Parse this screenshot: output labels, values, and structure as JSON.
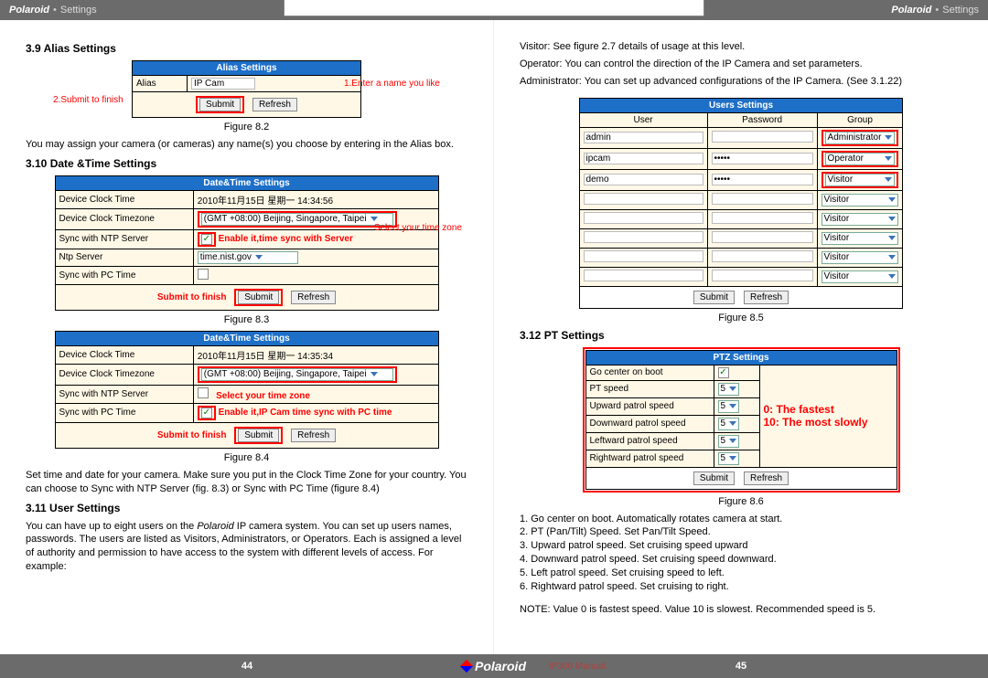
{
  "header": {
    "brand": "Polaroid",
    "sep": "•",
    "sub": "Settings"
  },
  "left": {
    "sec39_title": "3.9 Alias Settings",
    "fig82": {
      "title": "Alias Settings",
      "row_label": "Alias",
      "row_value": "IP Cam",
      "anno1": "1.Enter a name you like",
      "anno2": "2.Submit to finish",
      "submit": "Submit",
      "refresh": "Refresh",
      "caption": "Figure 8.2"
    },
    "p39": "You may assign your camera (or cameras) any name(s) you choose by entering in the Alias box.",
    "sec310_title": "3.10 Date &Time Settings",
    "fig83": {
      "title": "Date&Time Settings",
      "rows": {
        "dct_label": "Device Clock Time",
        "dct_value": "2010年11月15日 星期一 14:34:56",
        "dtz_label": "Device Clock Timezone",
        "dtz_value": "(GMT +08:00) Beijing, Singapore, Taipei",
        "ntp_label": "Sync with NTP Server",
        "ntp_anno": "Enable it,time sync with Server",
        "select_zone": "Select your time zone",
        "nsrv_label": "Ntp Server",
        "nsrv_value": "time.nist.gov",
        "pc_label": "Sync with PC Time"
      },
      "submit_to_finish": "Submit to finish",
      "submit": "Submit",
      "refresh": "Refresh",
      "caption": "Figure 8.3"
    },
    "fig84": {
      "title": "Date&Time Settings",
      "rows": {
        "dct_label": "Device Clock Time",
        "dct_value": "2010年11月15日 星期一 14:35:34",
        "dtz_label": "Device Clock Timezone",
        "dtz_value": "(GMT +08:00) Beijing, Singapore, Taipei",
        "ntp_label": "Sync with NTP Server",
        "select_zone": "Select your time zone",
        "pc_label": "Sync with PC Time",
        "pc_anno": "Enable it,IP Cam time sync with PC time"
      },
      "submit_to_finish": "Submit to finish",
      "submit": "Submit",
      "refresh": "Refresh",
      "caption": "Figure 8.4"
    },
    "p310": "Set time and date for your camera. Make sure you put in the Clock Time Zone for your country. You can choose to Sync with NTP Server (fig. 8.3) or Sync with PC Time (figure 8.4)",
    "sec311_title": "3.11 User Settings",
    "p311_1": "You can have up to eight users on the ",
    "p311_brand": "Polaroid",
    "p311_2": " IP camera system. You can set up users names, passwords. The users are listed as Visitors, Administrators, or Operators. Each is assigned a level of authority and permission to have access to the system with different levels of access. For example:"
  },
  "right": {
    "intro1": "Visitor: See figure 2.7 details of usage at this level.",
    "intro2": "Operator: You can control the direction of the IP Camera and set parameters.",
    "intro3": "Administrator: You can set up advanced configurations of the IP Camera. (See 3.1.22)",
    "fig85": {
      "title": "Users Settings",
      "headers": {
        "user": "User",
        "password": "Password",
        "group": "Group"
      },
      "rows": [
        {
          "user": "admin",
          "password": "",
          "group": "Administrator"
        },
        {
          "user": "ipcam",
          "password": "•••••",
          "group": "Operator"
        },
        {
          "user": "demo",
          "password": "•••••",
          "group": "Visitor"
        },
        {
          "user": "",
          "password": "",
          "group": "Visitor"
        },
        {
          "user": "",
          "password": "",
          "group": "Visitor"
        },
        {
          "user": "",
          "password": "",
          "group": "Visitor"
        },
        {
          "user": "",
          "password": "",
          "group": "Visitor"
        },
        {
          "user": "",
          "password": "",
          "group": "Visitor"
        }
      ],
      "submit": "Submit",
      "refresh": "Refresh",
      "caption": "Figure 8.5"
    },
    "sec312_title": "3.12 PT Settings",
    "fig86": {
      "title": "PTZ Settings",
      "rows": [
        {
          "label": "Go center on boot",
          "value": "",
          "checkbox": true
        },
        {
          "label": "PT speed",
          "value": "5"
        },
        {
          "label": "Upward patrol speed",
          "value": "5"
        },
        {
          "label": "Downward patrol speed",
          "value": "5"
        },
        {
          "label": "Leftward patrol speed",
          "value": "5"
        },
        {
          "label": "Rightward patrol speed",
          "value": "5"
        }
      ],
      "anno1": "0:  The fastest",
      "anno2": "10: The most slowly",
      "submit": "Submit",
      "refresh": "Refresh",
      "caption": "Figure 8.6"
    },
    "list": {
      "l1": "1. Go center on boot. Automatically rotates camera at start.",
      "l2": "2. PT (Pan/Tilt) Speed. Set Pan/Tilt Speed.",
      "l3": "3. Upward patrol speed. Set cruising speed upward",
      "l4": "4. Downward patrol speed. Set cruising speed downward.",
      "l5": "5. Left patrol speed. Set cruising speed to left.",
      "l6": "6. Rightward patrol speed. Set cruising to right."
    },
    "note": "NOTE: Value 0 is fastest speed. Value 10 is slowest. Recommended speed is 5."
  },
  "footer": {
    "pageL": "44",
    "pageR": "45",
    "brand": "Polaroid",
    "manual": "IP300 Manual"
  }
}
